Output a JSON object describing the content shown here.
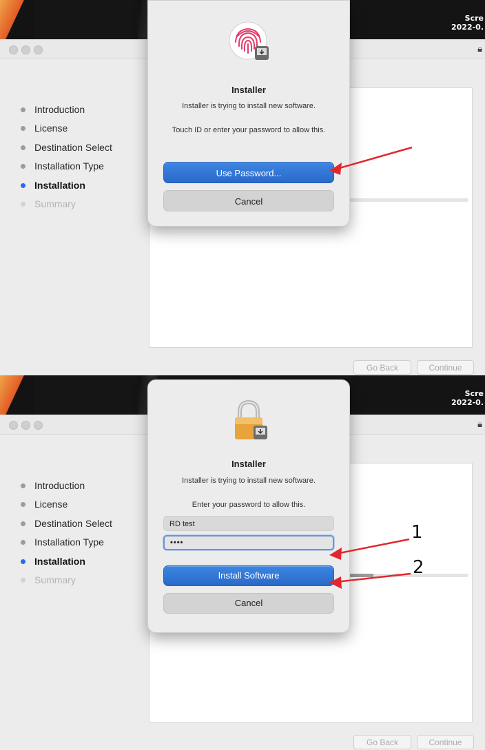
{
  "menu_bar": {
    "line1": "Scre",
    "line2": "2022-0."
  },
  "sidebar": {
    "items": [
      {
        "label": "Introduction",
        "state": "done"
      },
      {
        "label": "License",
        "state": "done"
      },
      {
        "label": "Destination Select",
        "state": "done"
      },
      {
        "label": "Installation Type",
        "state": "done"
      },
      {
        "label": "Installation",
        "state": "active"
      },
      {
        "label": "Summary",
        "state": "pending"
      }
    ]
  },
  "footer": {
    "go_back": "Go Back",
    "continue": "Continue"
  },
  "panel_1": {
    "menu_line1": "Scre",
    "menu_line2": "2022-0.",
    "dialog": {
      "title": "Installer",
      "message": "Installer is trying to install new software.",
      "prompt": "Touch ID or enter your password to allow this.",
      "primary_button": "Use Password...",
      "cancel_button": "Cancel",
      "icon": "fingerprint-icon"
    },
    "progress": 0
  },
  "panel_2": {
    "menu_line1": "Scre",
    "menu_line2": "2022-0.",
    "dialog": {
      "title": "Installer",
      "message": "Installer is trying to install new software.",
      "prompt": "Enter your password to allow this.",
      "username_value": "RD test",
      "password_value": "••••",
      "primary_button": "Install Software",
      "cancel_button": "Cancel",
      "icon": "padlock-icon"
    },
    "progress": 0.2
  },
  "annotations": {
    "label_1": "1",
    "label_2": "2",
    "arrow_color": "#e3262d"
  },
  "colors": {
    "accent": "#2b6be6",
    "primary_button": "#2f72d4"
  }
}
